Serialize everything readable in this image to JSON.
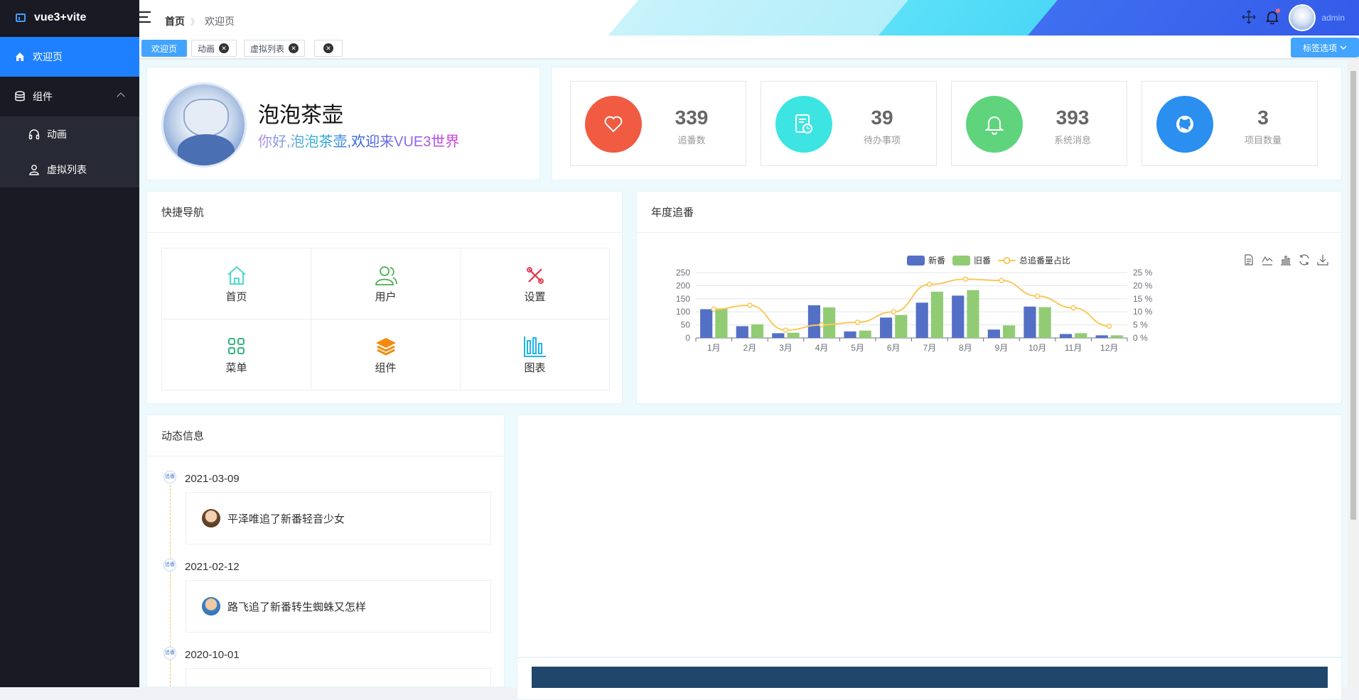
{
  "app": {
    "title": "vue3+vite"
  },
  "sidebar": {
    "items": [
      {
        "label": "欢迎页"
      }
    ],
    "group": {
      "label": "组件",
      "children": [
        {
          "label": "动画"
        },
        {
          "label": "虚拟列表"
        }
      ]
    }
  },
  "header": {
    "breadcrumb": [
      "首页",
      "欢迎页"
    ],
    "username": "admin"
  },
  "tags": {
    "items": [
      {
        "label": "欢迎页"
      },
      {
        "label": "动画"
      },
      {
        "label": "虚拟列表"
      }
    ],
    "options_label": "标签选项"
  },
  "profile": {
    "name": "泡泡茶壶",
    "greeting": "你好,泡泡茶壶,欢迎来VUE3世界"
  },
  "stats": [
    {
      "value": "339",
      "label": "追番数",
      "color": "#f05b41",
      "icon": "heart-icon"
    },
    {
      "value": "39",
      "label": "待办事项",
      "color": "#3de5e2",
      "icon": "todo-icon"
    },
    {
      "value": "393",
      "label": "系统消息",
      "color": "#5fd47d",
      "icon": "bell-icon"
    },
    {
      "value": "3",
      "label": "项目数量",
      "color": "#2b8ff0",
      "icon": "github-icon"
    }
  ],
  "quicknav": {
    "title": "快捷导航",
    "items": [
      {
        "label": "首页",
        "icon": "home-icon",
        "color": "#3dd6c7"
      },
      {
        "label": "用户",
        "icon": "user-icon",
        "color": "#4caf50"
      },
      {
        "label": "设置",
        "icon": "tools-icon",
        "color": "#e5364c"
      },
      {
        "label": "菜单",
        "icon": "menu-icon",
        "color": "#35b37e"
      },
      {
        "label": "组件",
        "icon": "layers-icon",
        "color": "#f28b0c"
      },
      {
        "label": "图表",
        "icon": "chart-icon",
        "color": "#1fb6e9"
      }
    ]
  },
  "chart_card": {
    "title": "年度追番"
  },
  "activity": {
    "title": "动态信息",
    "items": [
      {
        "date": "2021-03-09",
        "text": "平泽唯追了新番轻音少女"
      },
      {
        "date": "2021-02-12",
        "text": "路飞追了新番转生蜘蛛又怎样"
      },
      {
        "date": "2020-10-01",
        "text": ""
      }
    ]
  },
  "chart_data": {
    "type": "bar",
    "categories": [
      "1月",
      "2月",
      "3月",
      "4月",
      "5月",
      "6月",
      "7月",
      "8月",
      "9月",
      "10月",
      "11月",
      "12月"
    ],
    "series": [
      {
        "name": "新番",
        "type": "bar",
        "color": "#5470c6",
        "values": [
          110,
          45,
          18,
          125,
          25,
          78,
          135,
          162,
          32,
          120,
          15,
          10
        ]
      },
      {
        "name": "旧番",
        "type": "bar",
        "color": "#91cc75",
        "values": [
          112,
          52,
          20,
          117,
          28,
          88,
          177,
          183,
          48,
          118,
          18,
          10
        ]
      },
      {
        "name": "总追番量占比",
        "type": "line",
        "axis": "right",
        "color": "#fac858",
        "values": [
          11,
          12.5,
          3,
          5,
          6,
          10,
          20.5,
          22.5,
          22,
          16,
          11.5,
          4.5
        ]
      }
    ],
    "ylim": [
      0,
      250
    ],
    "yticks": [
      "0",
      "50",
      "100",
      "150",
      "200",
      "250"
    ],
    "y2lim": [
      0,
      25
    ],
    "y2ticks": [
      "0 %",
      "5 %",
      "10 %",
      "15 %",
      "20 %",
      "25 %"
    ],
    "legend": "top-center"
  }
}
